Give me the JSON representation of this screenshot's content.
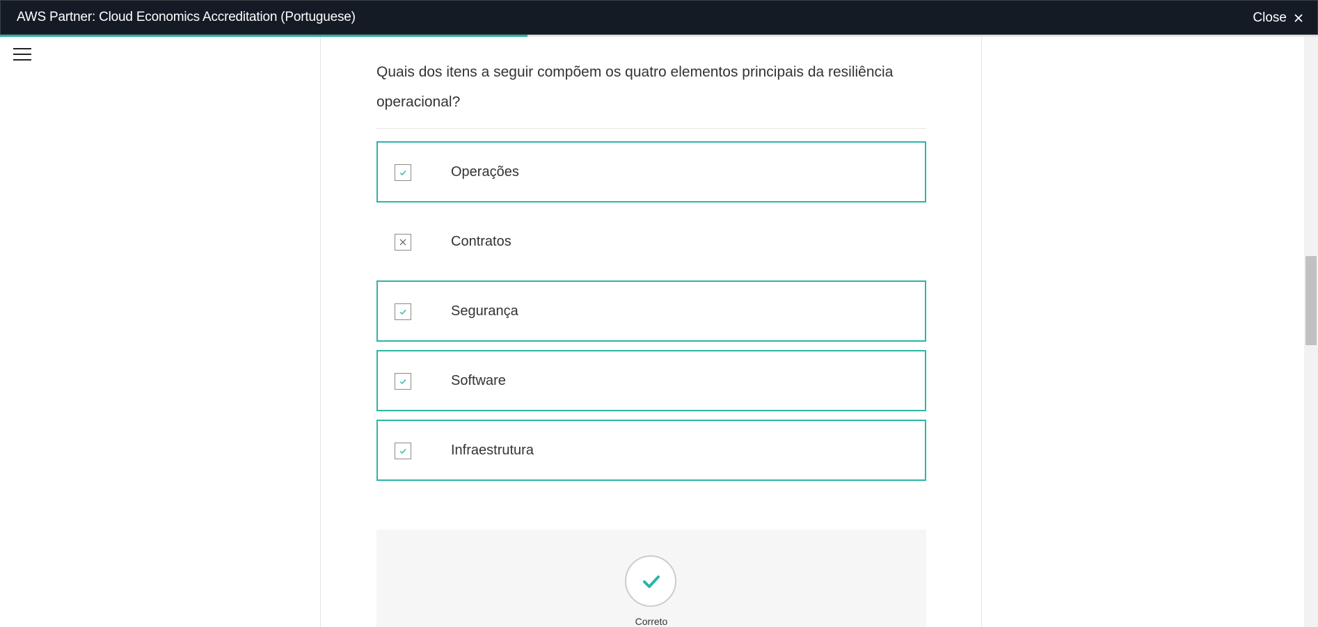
{
  "header": {
    "title": "AWS Partner: Cloud Economics Accreditation (Portuguese)",
    "close_label": "Close",
    "close_icon": "close-icon"
  },
  "progress": {
    "fraction": 0.4
  },
  "menu": {
    "icon": "hamburger-menu-icon"
  },
  "question": {
    "text": "Quais dos itens a seguir compõem os quatro elementos principais da resiliência operacional?",
    "options": [
      {
        "label": "Operações",
        "selected": true,
        "mark": "check"
      },
      {
        "label": "Contratos",
        "selected": false,
        "mark": "cross"
      },
      {
        "label": "Segurança",
        "selected": true,
        "mark": "check"
      },
      {
        "label": "Software",
        "selected": true,
        "mark": "check"
      },
      {
        "label": "Infraestrutura",
        "selected": true,
        "mark": "check"
      }
    ]
  },
  "feedback": {
    "icon": "checkmark-circle-icon",
    "result_label": "Correto"
  },
  "colors": {
    "accent": "#2bb5a6",
    "header_bg": "#141b24"
  }
}
